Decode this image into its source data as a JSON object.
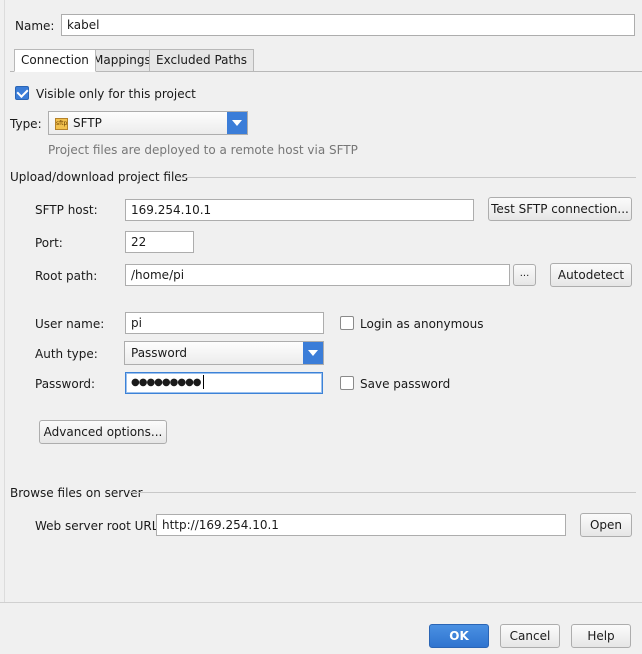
{
  "name": {
    "label": "Name:",
    "mnemonic": "N",
    "value": "kabel"
  },
  "tabs": [
    {
      "label": "Connection",
      "active": true
    },
    {
      "label": "Mappings",
      "active": false
    },
    {
      "label": "Excluded Paths",
      "active": false
    }
  ],
  "visible_only": {
    "label": "Visible only for this project",
    "checked": true
  },
  "type": {
    "label": "Type:",
    "value": "SFTP",
    "icon": "sftp-icon",
    "icon_text": "sftp",
    "hint": "Project files are deployed to a remote host via SFTP"
  },
  "upload_section": {
    "title": "Upload/download project files"
  },
  "sftp_host": {
    "label": "SFTP host:",
    "value": "169.254.10.1",
    "test_button": "Test SFTP connection..."
  },
  "port": {
    "label": "Port:",
    "value": "22"
  },
  "root_path": {
    "label": "Root path:",
    "value": "/home/pi",
    "browse_button": "...",
    "autodetect_button": "Autodetect"
  },
  "user_name": {
    "label": "User name:",
    "value": "pi",
    "anonymous_label": "Login as anonymous",
    "anonymous_checked": false
  },
  "auth_type": {
    "label": "Auth type:",
    "value": "Password"
  },
  "password": {
    "label": "Password:",
    "value": "●●●●●●●●●",
    "save_label": "Save password",
    "save_checked": false
  },
  "advanced_button": "Advanced options...",
  "browse_section": {
    "title": "Browse files on server"
  },
  "web_root": {
    "label": "Web server root URL:",
    "value": "http://169.254.10.1",
    "open_button": "Open"
  },
  "footer": {
    "ok": "OK",
    "cancel": "Cancel",
    "help": "Help"
  },
  "colors": {
    "accent": "#3b7dd8",
    "background": "#f0f0f0"
  }
}
